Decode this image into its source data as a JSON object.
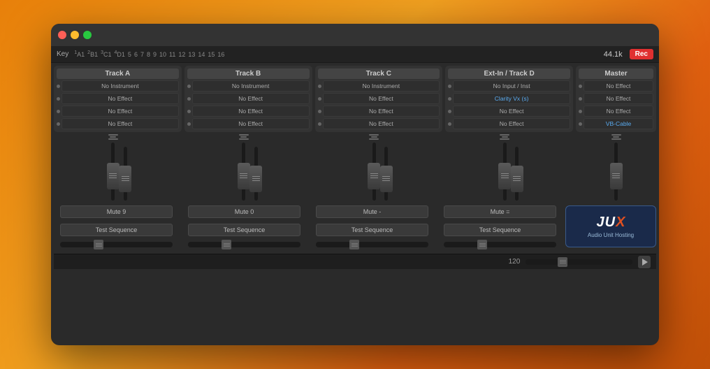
{
  "window": {
    "title": "JUX Audio Unit Hosting"
  },
  "transport": {
    "key_label": "Key",
    "markers": [
      "A1",
      "B1",
      "C1",
      "D1",
      "5",
      "6",
      "7",
      "8",
      "9",
      "10",
      "11",
      "12",
      "13",
      "14",
      "15",
      "16"
    ],
    "marker_nums": [
      "1",
      "2",
      "3",
      "4",
      "",
      "",
      "",
      "",
      "",
      "",
      "",
      "",
      "",
      "",
      "",
      ""
    ],
    "rate": "44.1k",
    "rec": "Rec"
  },
  "tracks": [
    {
      "id": "track-a",
      "label": "Track A",
      "slots": [
        {
          "text": "No Instrument",
          "style": ""
        },
        {
          "text": "No Effect",
          "style": ""
        },
        {
          "text": "No Effect",
          "style": ""
        },
        {
          "text": "No Effect",
          "style": ""
        }
      ]
    },
    {
      "id": "track-b",
      "label": "Track B",
      "slots": [
        {
          "text": "No Instrument",
          "style": ""
        },
        {
          "text": "No Effect",
          "style": ""
        },
        {
          "text": "No Effect",
          "style": ""
        },
        {
          "text": "No Effect",
          "style": ""
        }
      ]
    },
    {
      "id": "track-c",
      "label": "Track C",
      "slots": [
        {
          "text": "No Instrument",
          "style": ""
        },
        {
          "text": "No Effect",
          "style": ""
        },
        {
          "text": "No Effect",
          "style": ""
        },
        {
          "text": "No Effect",
          "style": ""
        }
      ]
    },
    {
      "id": "track-d",
      "label": "Ext-In / Track D",
      "slots": [
        {
          "text": "No Input / Inst",
          "style": ""
        },
        {
          "text": "Clarity Vx (s)",
          "style": "blue"
        },
        {
          "text": "No Effect",
          "style": ""
        },
        {
          "text": "No Effect",
          "style": ""
        }
      ]
    },
    {
      "id": "master",
      "label": "Master",
      "slots": [
        {
          "text": "No Effect",
          "style": ""
        },
        {
          "text": "No Effect",
          "style": ""
        },
        {
          "text": "No Effect",
          "style": ""
        },
        {
          "text": "VB-Cable",
          "style": "blue"
        }
      ]
    }
  ],
  "bottom_controls": [
    {
      "mute": "Mute  9",
      "seq": "Test Sequence"
    },
    {
      "mute": "Mute  0",
      "seq": "Test Sequence"
    },
    {
      "mute": "Mute  -",
      "seq": "Test Sequence"
    },
    {
      "mute": "Mute  =",
      "seq": "Test Sequence"
    }
  ],
  "logo": {
    "title": "JUX",
    "x_letter": "X",
    "subtitle": "Audio Unit Hosting"
  },
  "playback": {
    "tempo": "120",
    "play_label": "▶"
  }
}
